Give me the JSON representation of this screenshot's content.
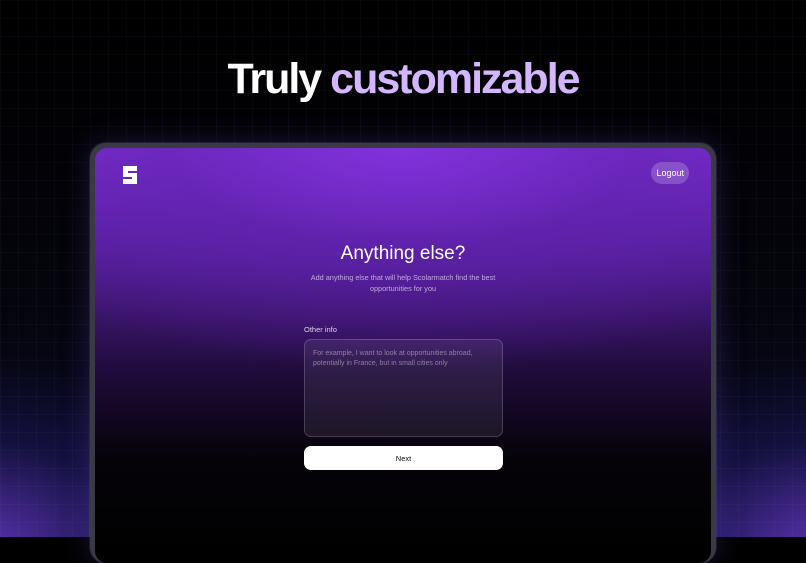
{
  "hero": {
    "headline_part1": "Truly",
    "headline_part2": "customizable"
  },
  "app": {
    "logo_icon": "scolarmatch-s-logo",
    "logout_label": "Logout"
  },
  "form": {
    "title": "Anything else?",
    "subtitle": "Add anything else that will help Scolarmatch find the best opportunities for you",
    "field_label": "Other info",
    "field_placeholder": "For example, I want to look at opportunities abroad, potentially in France, but in small cities only",
    "field_value": "",
    "next_label": "Next"
  },
  "colors": {
    "accent_purple": "#7a2fd0",
    "headline_highlight": "#d4b6ff",
    "background": "#000000",
    "button_bg": "#ffffff"
  }
}
